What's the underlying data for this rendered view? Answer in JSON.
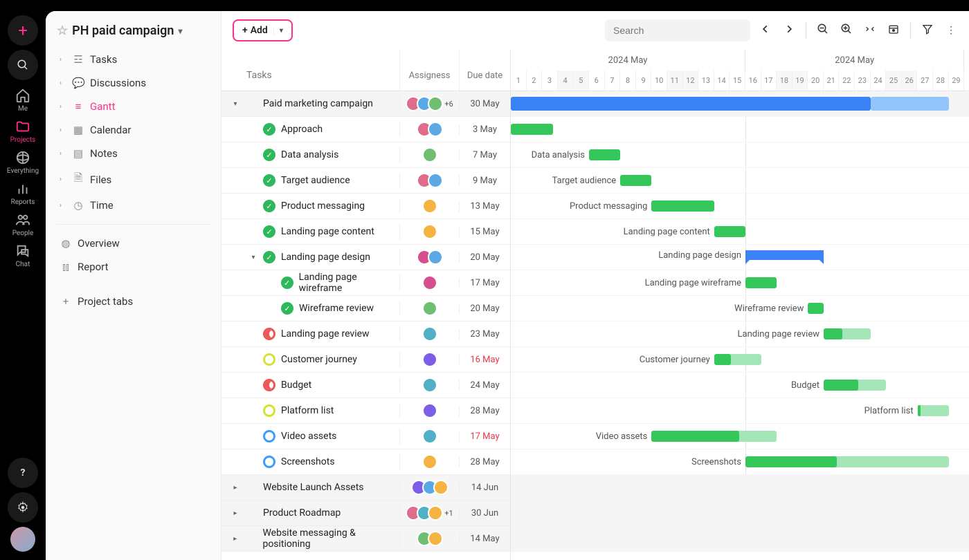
{
  "rail": {
    "items": [
      {
        "id": "me",
        "label": "Me"
      },
      {
        "id": "projects",
        "label": "Projects"
      },
      {
        "id": "everything",
        "label": "Everything"
      },
      {
        "id": "reports",
        "label": "Reports"
      },
      {
        "id": "people",
        "label": "People"
      },
      {
        "id": "chat",
        "label": "Chat"
      }
    ]
  },
  "project": {
    "title": "PH paid campaign",
    "nav": [
      {
        "label": "Tasks",
        "icon": "list"
      },
      {
        "label": "Discussions",
        "icon": "chat"
      },
      {
        "label": "Gantt",
        "icon": "gantt",
        "active": true
      },
      {
        "label": "Calendar",
        "icon": "calendar"
      },
      {
        "label": "Notes",
        "icon": "note"
      },
      {
        "label": "Files",
        "icon": "file"
      },
      {
        "label": "Time",
        "icon": "clock"
      }
    ],
    "nav2": [
      {
        "label": "Overview",
        "icon": "gauge"
      },
      {
        "label": "Report",
        "icon": "bars"
      }
    ],
    "add_tabs_label": "Project tabs"
  },
  "toolbar": {
    "add_label": "Add",
    "search_placeholder": "Search"
  },
  "columns": {
    "tasks": "Tasks",
    "assignees": "Assigness",
    "due": "Due date"
  },
  "timeline": {
    "month_label": "2024 May",
    "day_start": 1,
    "day_end": 29,
    "weekends": [
      4,
      5,
      11,
      12,
      18,
      19,
      25,
      26
    ]
  },
  "avatar_colors": {
    "a": "#e06b8b",
    "b": "#5aa9e6",
    "c": "#6fbf73",
    "d": "#f5b342",
    "e": "#7c5fe6",
    "f": "#d64f8e",
    "g": "#4fb0c6"
  },
  "tasks": [
    {
      "name": "Paid marketing campaign",
      "indent": 0,
      "caret": "down",
      "status": "blank",
      "avatars": [
        "a",
        "b",
        "c"
      ],
      "more": "+6",
      "due": "30 May",
      "group": true,
      "bar": {
        "type": "blue",
        "start": 1,
        "end": 24,
        "tail_end": 29
      }
    },
    {
      "name": "Approach",
      "indent": 1,
      "status": "done",
      "avatars": [
        "a",
        "b"
      ],
      "due": "3 May",
      "bar": {
        "type": "green",
        "start": 1,
        "end": 3.7,
        "link_to": 1
      }
    },
    {
      "name": "Data analysis",
      "indent": 1,
      "status": "done",
      "avatars": [
        "c"
      ],
      "due": "7 May",
      "bar": {
        "type": "green",
        "start": 6,
        "end": 8,
        "label": "Data analysis",
        "link_to": 2
      }
    },
    {
      "name": "Target audience",
      "indent": 1,
      "status": "done",
      "avatars": [
        "a",
        "b"
      ],
      "due": "9 May",
      "bar": {
        "type": "green",
        "start": 8,
        "end": 10,
        "label": "Target audience",
        "link_to": 3
      }
    },
    {
      "name": "Product messaging",
      "indent": 1,
      "status": "done",
      "avatars": [
        "d"
      ],
      "due": "13 May",
      "bar": {
        "type": "green",
        "start": 10,
        "end": 14,
        "label": "Product messaging",
        "link_to": 4
      }
    },
    {
      "name": "Landing page content",
      "indent": 1,
      "status": "done",
      "avatars": [
        "d"
      ],
      "due": "15 May",
      "bar": {
        "type": "green",
        "start": 14,
        "end": 16,
        "label": "Landing page content",
        "link_to": 5
      }
    },
    {
      "name": "Landing page design",
      "indent": 1,
      "caret": "down",
      "status": "done",
      "avatars": [
        "f",
        "b"
      ],
      "due": "20 May",
      "bar": {
        "type": "bracket",
        "start": 16,
        "end": 21,
        "label": "Landing page design"
      }
    },
    {
      "name": "Landing page wireframe",
      "indent": 2,
      "status": "done",
      "avatars": [
        "f"
      ],
      "due": "17 May",
      "bar": {
        "type": "green",
        "start": 16,
        "end": 18,
        "label": "Landing page wireframe",
        "link_to": 7
      }
    },
    {
      "name": "Wireframe review",
      "indent": 2,
      "status": "done",
      "avatars": [
        "c"
      ],
      "due": "20 May",
      "bar": {
        "type": "green",
        "start": 20,
        "end": 21,
        "label": "Wireframe review",
        "link_to": 8
      }
    },
    {
      "name": "Landing page review",
      "indent": 1,
      "status": "half-red",
      "avatars": [
        "g"
      ],
      "due": "23 May",
      "bar": {
        "type": "green-prog",
        "start": 21,
        "end": 24,
        "prog": 0.4,
        "label": "Landing page review"
      }
    },
    {
      "name": "Customer journey",
      "indent": 1,
      "status": "ring-yel",
      "avatars": [
        "e"
      ],
      "due": "16 May",
      "overdue": true,
      "bar": {
        "type": "green-prog",
        "start": 14,
        "end": 17,
        "prog": 0.35,
        "label": "Customer journey"
      }
    },
    {
      "name": "Budget",
      "indent": 1,
      "status": "half-red",
      "avatars": [
        "g"
      ],
      "due": "24 May",
      "bar": {
        "type": "green-prog",
        "start": 21,
        "end": 25,
        "prog": 0.55,
        "label": "Budget",
        "link_to": 11
      }
    },
    {
      "name": "Platform list",
      "indent": 1,
      "status": "ring-yel",
      "avatars": [
        "e"
      ],
      "due": "28 May",
      "bar": {
        "type": "green-prog",
        "start": 27,
        "end": 29,
        "prog": 0.1,
        "label": "Platform list"
      }
    },
    {
      "name": "Video assets",
      "indent": 1,
      "status": "ring-blue",
      "avatars": [
        "g"
      ],
      "due": "17 May",
      "overdue": true,
      "bar": {
        "type": "green-prog",
        "start": 10,
        "end": 18,
        "prog": 0.7,
        "label": "Video assets"
      }
    },
    {
      "name": "Screenshots",
      "indent": 1,
      "status": "ring-blue",
      "avatars": [
        "d"
      ],
      "due": "28 May",
      "bar": {
        "type": "green-prog",
        "start": 16,
        "end": 29,
        "prog": 0.45,
        "label": "Screenshots"
      }
    },
    {
      "name": "Website Launch Assets",
      "indent": 0,
      "caret": "right",
      "status": "blank",
      "avatars": [
        "e",
        "b",
        "d"
      ],
      "due": "14 Jun",
      "group": true
    },
    {
      "name": "Product Roadmap",
      "indent": 0,
      "caret": "right",
      "status": "blank",
      "avatars": [
        "a",
        "g",
        "d"
      ],
      "more": "+1",
      "due": "30 Jun",
      "group": true
    },
    {
      "name": "Website messaging & positioning",
      "indent": 0,
      "caret": "right",
      "status": "blank",
      "avatars": [
        "c",
        "d"
      ],
      "due": "14 May",
      "group": true
    }
  ]
}
